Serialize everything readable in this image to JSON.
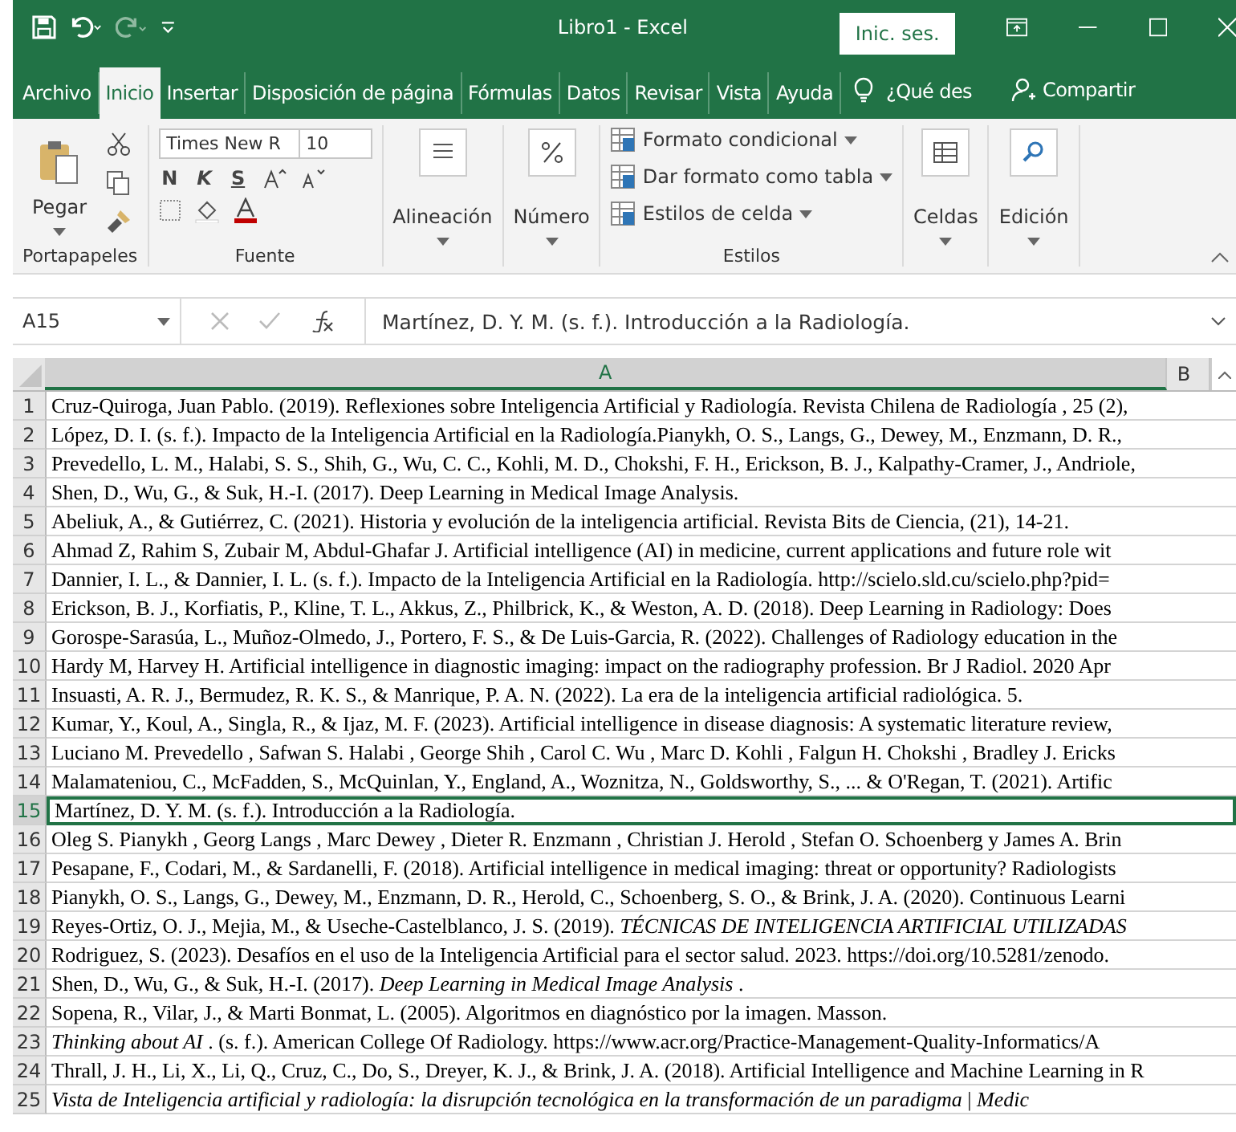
{
  "window": {
    "title": "Libro1  -  Excel",
    "sign_in": "Inic. ses."
  },
  "tabs": [
    {
      "label": "Archivo",
      "selected": false
    },
    {
      "label": "Inicio",
      "selected": true
    },
    {
      "label": "Insertar",
      "selected": false
    },
    {
      "label": "Disposición de página",
      "selected": false
    },
    {
      "label": "Fórmulas",
      "selected": false
    },
    {
      "label": "Datos",
      "selected": false
    },
    {
      "label": "Revisar",
      "selected": false
    },
    {
      "label": "Vista",
      "selected": false
    },
    {
      "label": "Ayuda",
      "selected": false
    }
  ],
  "tell_me": "¿Qué des",
  "share": "Compartir",
  "ribbon": {
    "clipboard": {
      "paste": "Pegar",
      "label": "Portapapeles"
    },
    "font": {
      "name": "Times New R",
      "size": "10",
      "bold": "N",
      "italic": "K",
      "underline": "S",
      "label": "Fuente"
    },
    "alignment": "Alineación",
    "number": "Número",
    "styles": {
      "items": [
        "Formato condicional",
        "Dar formato como tabla",
        "Estilos de celda"
      ],
      "label": "Estilos"
    },
    "cells": "Celdas",
    "editing": "Edición"
  },
  "formula_bar": {
    "name_box": "A15",
    "content": "Martínez, D. Y. M. (s. f.). Introducción a la Radiología."
  },
  "sheet": {
    "columns": [
      "A",
      "B"
    ],
    "rows": [
      {
        "num": "1",
        "text": "Cruz-Quiroga, Juan Pablo. (2019). Reflexiones sobre Inteligencia Artificial y Radiología. Revista Chilena de Radiología , 25 (2),",
        "selected": false
      },
      {
        "num": "2",
        "text": "López, D. I. (s. f.). Impacto de la Inteligencia Artificial en la Radiología.Pianykh, O. S., Langs, G., Dewey, M., Enzmann, D. R.,",
        "selected": false
      },
      {
        "num": "3",
        "text": "Prevedello, L. M., Halabi, S. S., Shih, G., Wu, C. C., Kohli, M. D., Chokshi, F. H., Erickson, B. J., Kalpathy-Cramer, J., Andriole,",
        "selected": false
      },
      {
        "num": "4",
        "text": "Shen, D., Wu, G., & Suk, H.-I. (2017). Deep Learning in Medical Image Analysis.",
        "selected": false
      },
      {
        "num": "5",
        "text": "Abeliuk, A., & Gutiérrez, C. (2021). Historia y evolución de la inteligencia artificial. Revista Bits de Ciencia, (21), 14-21.",
        "selected": false
      },
      {
        "num": "6",
        "text": "Ahmad Z, Rahim S, Zubair M, Abdul-Ghafar J. Artificial intelligence (AI) in medicine, current applications and future role wit",
        "selected": false
      },
      {
        "num": "7",
        "text": "Dannier, I. L., & Dannier, I. L. (s. f.). Impacto de la Inteligencia Artificial en la Radiología. http://scielo.sld.cu/scielo.php?pid=",
        "selected": false
      },
      {
        "num": "8",
        "text": "Erickson, B. J., Korfiatis, P., Kline, T. L., Akkus, Z., Philbrick, K., & Weston, A. D. (2018). Deep Learning in Radiology: Does",
        "selected": false
      },
      {
        "num": "9",
        "text": "Gorospe-Sarasúa, L., Muñoz-Olmedo, J., Portero, F. S., & De Luis-Garcia, R. (2022). Challenges of Radiology education in the",
        "selected": false
      },
      {
        "num": "10",
        "text": "Hardy M, Harvey H. Artificial intelligence in diagnostic imaging: impact on the radiography profession. Br J Radiol. 2020 Apr",
        "selected": false
      },
      {
        "num": "11",
        "text": "Insuasti, A. R. J., Bermudez, R. K. S., & Manrique, P. A. N. (2022). La era de la inteligencia artificial radiológica. 5.",
        "selected": false
      },
      {
        "num": "12",
        "text": "Kumar, Y., Koul, A., Singla, R., & Ijaz, M. F. (2023). Artificial intelligence in disease diagnosis: A systematic literature review,",
        "selected": false
      },
      {
        "num": "13",
        "text": "Luciano M. Prevedello , Safwan S. Halabi , George Shih , Carol C. Wu , Marc D. Kohli , Falgun H. Chokshi , Bradley J. Ericks",
        "selected": false
      },
      {
        "num": "14",
        "text": "Malamateniou, C., McFadden, S., McQuinlan, Y., England, A., Woznitza, N., Goldsworthy, S., ... & O'Regan, T. (2021). Artific",
        "selected": false
      },
      {
        "num": "15",
        "text": "Martínez, D. Y. M. (s. f.). Introducción a la Radiología.",
        "selected": true
      },
      {
        "num": "16",
        "text": "Oleg S. Pianykh , Georg Langs , Marc Dewey , Dieter R. Enzmann , Christian J. Herold , Stefan O. Schoenberg y James A. Brin",
        "selected": false
      },
      {
        "num": "17",
        "text": "Pesapane, F., Codari, M., & Sardanelli, F. (2018). Artificial intelligence in medical imaging: threat or opportunity? Radiologists",
        "selected": false
      },
      {
        "num": "18",
        "text": "Pianykh, O. S., Langs, G., Dewey, M., Enzmann, D. R., Herold, C., Schoenberg, S. O., & Brink, J. A. (2020). Continuous Learni",
        "selected": false
      },
      {
        "num": "19",
        "text": "Reyes-Ortiz, O. J., Mejia, M., & Useche-Castelblanco, J. S. (2019). *TÉCNICAS DE INTELIGENCIA ARTIFICIAL UTILIZADAS*",
        "selected": false
      },
      {
        "num": "20",
        "text": "Rodriguez, S. (2023). Desafíos en el uso de la Inteligencia Artificial para el sector salud. 2023. https://doi.org/10.5281/zenodo.",
        "selected": false
      },
      {
        "num": "21",
        "text": "Shen, D., Wu, G., & Suk, H.-I. (2017). *Deep Learning in Medical Image Analysis* .",
        "selected": false
      },
      {
        "num": "22",
        "text": "Sopena, R., Vilar, J., & Marti Bonmat, L. (2005). Algoritmos en diagnóstico por la imagen. Masson.",
        "selected": false
      },
      {
        "num": "23",
        "text": "*Thinking about AI* . (s. f.). American College Of Radiology. https://www.acr.org/Practice-Management-Quality-Informatics/A",
        "selected": false
      },
      {
        "num": "24",
        "text": "Thrall, J. H., Li, X., Li, Q., Cruz, C., Do, S., Dreyer, K. J., & Brink, J. A. (2018). Artificial Intelligence and Machine Learning in R",
        "selected": false
      },
      {
        "num": "25",
        "text": "*Vista de Inteligencia artificial y radiología: la disrupción tecnológica en la transformación de un paradigma*   | *Medic*",
        "selected": false
      }
    ]
  }
}
